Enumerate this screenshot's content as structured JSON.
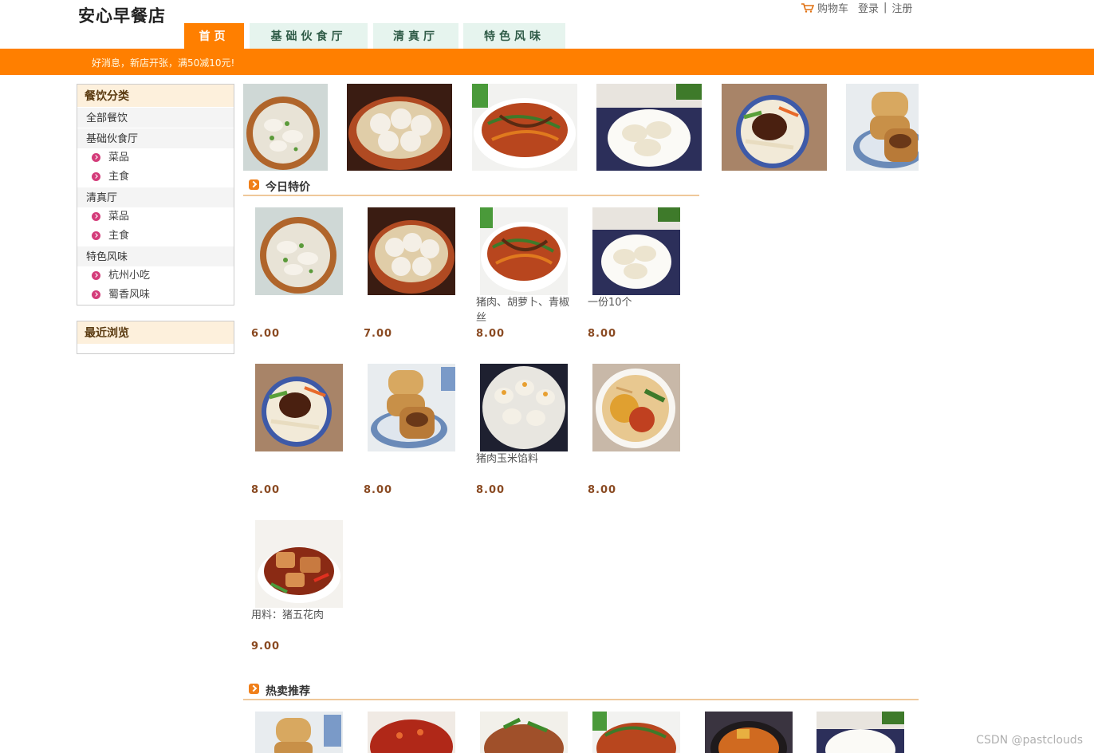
{
  "header": {
    "logo": "安心早餐店",
    "cart_label": "购物车",
    "login_label": "登录",
    "separator": "|",
    "register_label": "注册"
  },
  "nav": {
    "tabs": [
      {
        "label": "首页",
        "active": true
      },
      {
        "label": "基础伙食厅",
        "active": false
      },
      {
        "label": "清真厅",
        "active": false
      },
      {
        "label": "特色风味",
        "active": false
      }
    ]
  },
  "banner": {
    "text": "好消息，新店开张，满50减10元!"
  },
  "sidebar": {
    "category_title": "餐饮分类",
    "items": [
      {
        "label": "全部餐饮",
        "type": "group"
      },
      {
        "label": "基础伙食厅",
        "type": "group"
      },
      {
        "label": "菜品",
        "type": "sub"
      },
      {
        "label": "主食",
        "type": "sub"
      },
      {
        "label": "清真厅",
        "type": "group"
      },
      {
        "label": "菜品",
        "type": "sub"
      },
      {
        "label": "主食",
        "type": "sub"
      },
      {
        "label": "特色风味",
        "type": "group"
      },
      {
        "label": "杭州小吃",
        "type": "sub"
      },
      {
        "label": "蜀香风味",
        "type": "sub"
      }
    ],
    "recent_title": "最近浏览"
  },
  "today_special": {
    "title": "今日特价",
    "items": [
      {
        "desc": "",
        "price": "6.00"
      },
      {
        "desc": "",
        "price": "7.00"
      },
      {
        "desc": "猪肉、胡萝卜、青椒丝",
        "price": "8.00"
      },
      {
        "desc": "一份10个",
        "price": "8.00"
      },
      {
        "desc": "",
        "price": "8.00"
      },
      {
        "desc": "",
        "price": "8.00"
      },
      {
        "desc": "猪肉玉米馅料",
        "price": "8.00"
      },
      {
        "desc": "",
        "price": "8.00"
      },
      {
        "desc": "用料：猪五花肉",
        "price": "9.00"
      }
    ]
  },
  "hot_sale": {
    "title": "热卖推荐"
  },
  "watermark": "CSDN @pastclouds",
  "colors": {
    "accent": "#ff7f00",
    "tab_bg": "#e6f4ee",
    "price": "#8a4a22"
  }
}
